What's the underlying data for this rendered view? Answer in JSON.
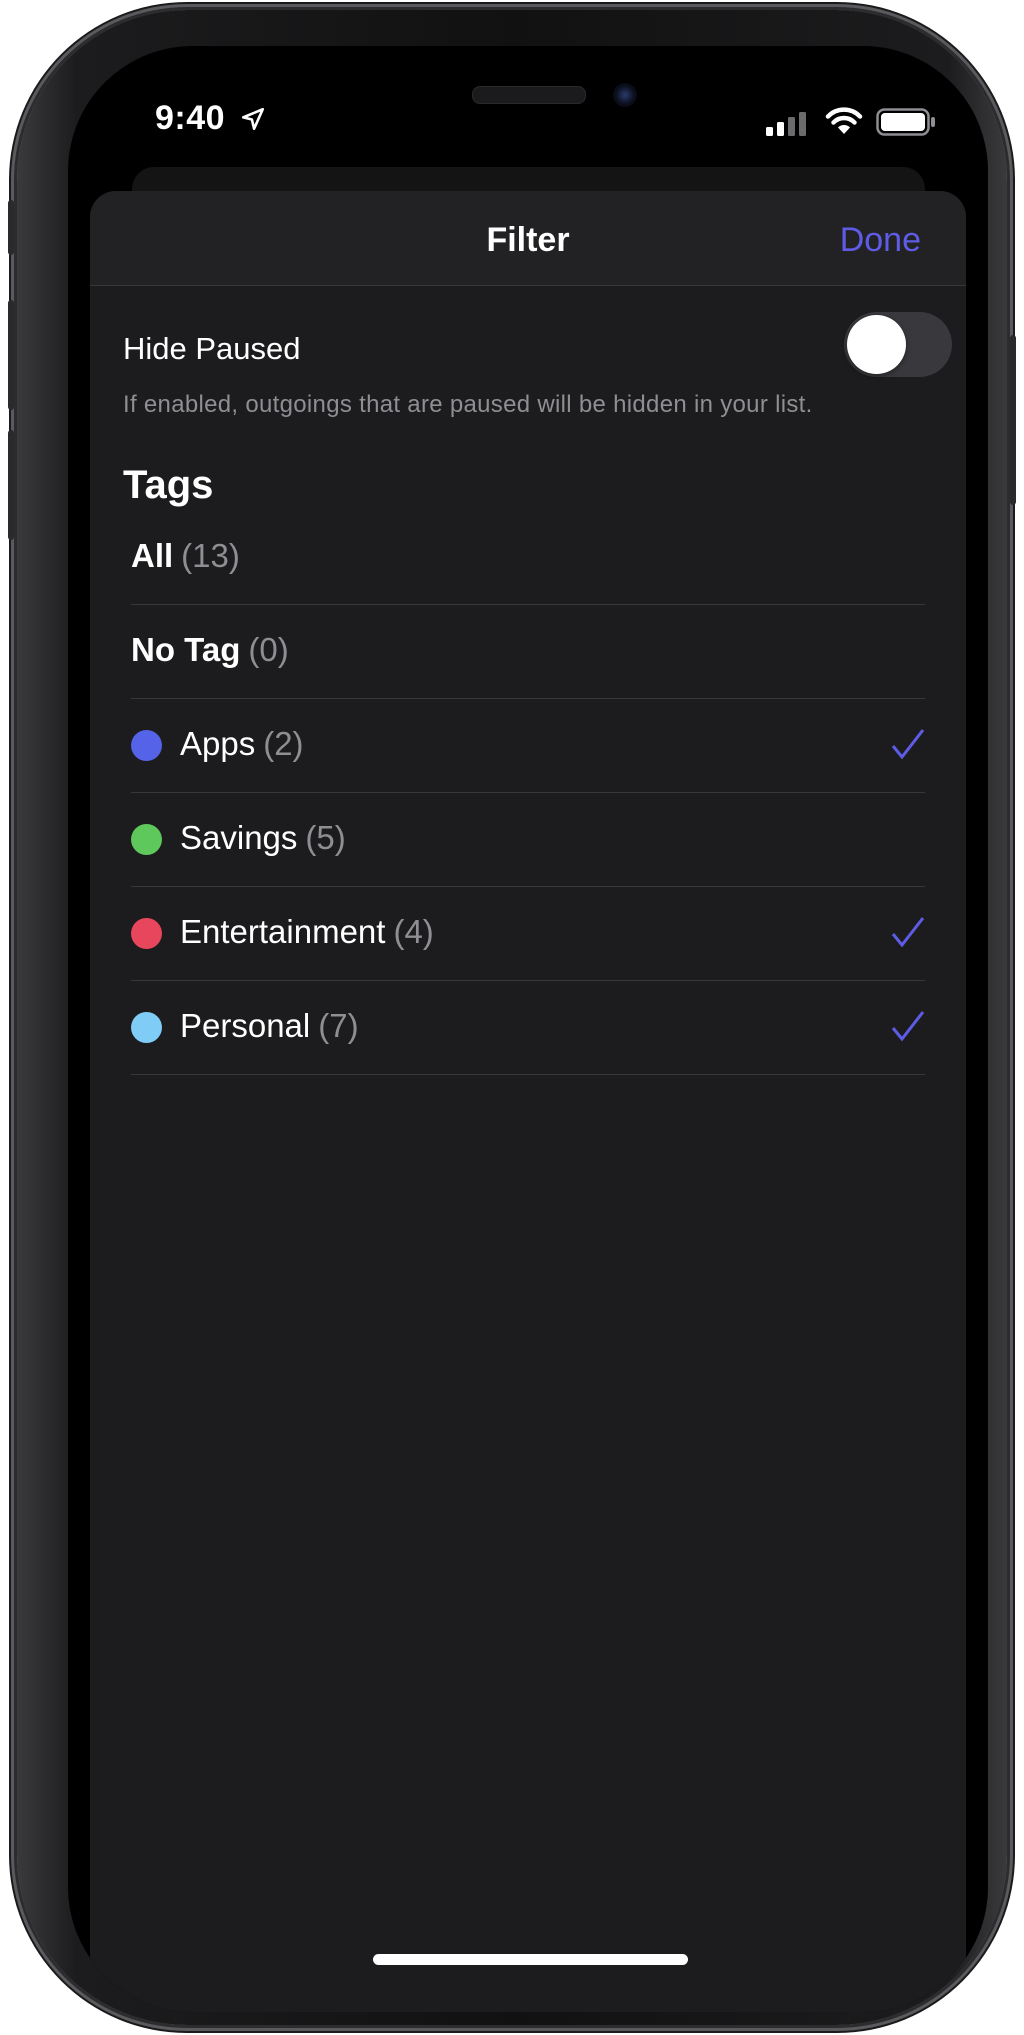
{
  "status_bar": {
    "time": "9:40",
    "icons": [
      "location-arrow-icon",
      "cellular-signal-icon",
      "wifi-icon",
      "battery-icon"
    ]
  },
  "nav": {
    "title": "Filter",
    "done_label": "Done"
  },
  "hide_paused": {
    "label": "Hide Paused",
    "enabled": false,
    "hint": "If enabled, outgoings that are paused will be hidden in your list."
  },
  "tags": {
    "title": "Tags",
    "items": [
      {
        "name": "All",
        "count": "(13)",
        "color": null,
        "checked": false,
        "bold": true
      },
      {
        "name": "No Tag",
        "count": "(0)",
        "color": null,
        "checked": false,
        "bold": true
      },
      {
        "name": "Apps",
        "count": "(2)",
        "color": "#5463e8",
        "checked": true,
        "bold": false
      },
      {
        "name": "Savings",
        "count": "(5)",
        "color": "#5fc85d",
        "checked": false,
        "bold": false
      },
      {
        "name": "Entertainment",
        "count": "(4)",
        "color": "#e8465c",
        "checked": true,
        "bold": false
      },
      {
        "name": "Personal",
        "count": "(7)",
        "color": "#7fcdf7",
        "checked": true,
        "bold": false
      }
    ]
  },
  "colors": {
    "accent": "#5e5ce6",
    "sheet_bg": "#1c1c1e",
    "separator": "#38383a"
  }
}
